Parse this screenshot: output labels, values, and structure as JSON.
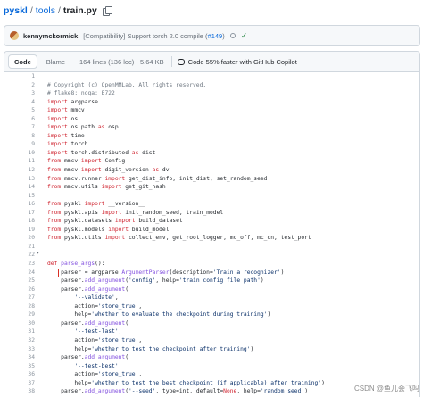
{
  "breadcrumb": {
    "repo": "pyskl",
    "folder": "tools",
    "file": "train.py",
    "separator": "/"
  },
  "commit": {
    "author": "kennymckormick",
    "message_prefix": "[Compatibility] Support torch 2.0 compile (",
    "pr": "#149",
    "message_suffix": ")"
  },
  "file_header": {
    "tab_code": "Code",
    "tab_blame": "Blame",
    "meta": "164 lines (136 loc) · 5.64 KB",
    "copilot": "Code 55% faster with GitHub Copilot"
  },
  "code_lines": [
    {
      "n": "1",
      "t": ""
    },
    {
      "n": "2",
      "t": "# Copyright (c) OpenMMLab. All rights reserved."
    },
    {
      "n": "3",
      "t": "# flake8: noqa: E722"
    },
    {
      "n": "4",
      "t": "import argparse"
    },
    {
      "n": "5",
      "t": "import mmcv"
    },
    {
      "n": "6",
      "t": "import os"
    },
    {
      "n": "7",
      "t": "import os.path as osp"
    },
    {
      "n": "8",
      "t": "import time"
    },
    {
      "n": "9",
      "t": "import torch"
    },
    {
      "n": "10",
      "t": "import torch.distributed as dist"
    },
    {
      "n": "11",
      "t": "from mmcv import Config"
    },
    {
      "n": "12",
      "t": "from mmcv import digit_version as dv"
    },
    {
      "n": "13",
      "t": "from mmcv.runner import get_dist_info, init_dist, set_random_seed"
    },
    {
      "n": "14",
      "t": "from mmcv.utils import get_git_hash"
    },
    {
      "n": "15",
      "t": ""
    },
    {
      "n": "16",
      "t": "from pyskl import __version__"
    },
    {
      "n": "17",
      "t": "from pyskl.apis import init_random_seed, train_model"
    },
    {
      "n": "18",
      "t": "from pyskl.datasets import build_dataset"
    },
    {
      "n": "19",
      "t": "from pyskl.models import build_model"
    },
    {
      "n": "20",
      "t": "from pyskl.utils import collect_env, get_root_logger, mc_off, mc_on, test_port"
    },
    {
      "n": "21",
      "t": ""
    },
    {
      "n": "22",
      "t": ""
    },
    {
      "n": "23",
      "t": "def parse_args():"
    },
    {
      "n": "24",
      "t": "    parser = argparse.ArgumentParser(description='Train a recognizer')"
    },
    {
      "n": "25",
      "t": "    parser.add_argument('config', help='train config file path')"
    },
    {
      "n": "26",
      "t": "    parser.add_argument("
    },
    {
      "n": "27",
      "t": "        '--validate',"
    },
    {
      "n": "28",
      "t": "        action='store_true',"
    },
    {
      "n": "29",
      "t": "        help='whether to evaluate the checkpoint during training')"
    },
    {
      "n": "30",
      "t": "    parser.add_argument("
    },
    {
      "n": "31",
      "t": "        '--test-last',"
    },
    {
      "n": "32",
      "t": "        action='store_true',"
    },
    {
      "n": "33",
      "t": "        help='whether to test the checkpoint after training')"
    },
    {
      "n": "34",
      "t": "    parser.add_argument("
    },
    {
      "n": "35",
      "t": "        '--test-best',"
    },
    {
      "n": "36",
      "t": "        action='store_true',"
    },
    {
      "n": "37",
      "t": "        help='whether to test the best checkpoint (if applicable) after training')"
    },
    {
      "n": "38",
      "t": "    parser.add_argument('--seed', type=int, default=None, help='random seed')"
    }
  ],
  "watermark": "CSDN @鱼儿会飞吗"
}
